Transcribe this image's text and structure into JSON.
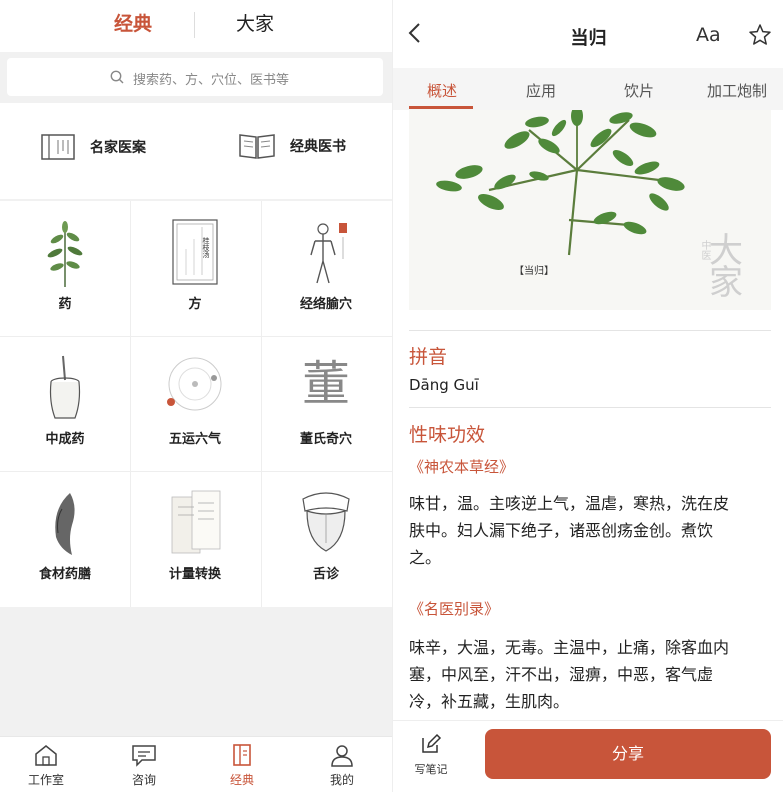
{
  "left": {
    "top_tabs": {
      "active": "经典",
      "inactive": "大家"
    },
    "search": {
      "placeholder": "搜索药、方、穴位、医书等"
    },
    "quick_links": [
      {
        "label": "名家医案",
        "icon": "scroll-icon"
      },
      {
        "label": "经典医书",
        "icon": "open-book-icon"
      }
    ],
    "grid": [
      {
        "label": "药",
        "icon": "herb-icon"
      },
      {
        "label": "方",
        "icon": "prescription-card-icon",
        "card_title": "桂枝汤"
      },
      {
        "label": "经络腧穴",
        "icon": "acupuncture-figure-icon"
      },
      {
        "label": "中成药",
        "icon": "medicine-jar-icon"
      },
      {
        "label": "五运六气",
        "icon": "orbit-icon"
      },
      {
        "label": "董氏奇穴",
        "icon": "dong-character-icon",
        "glyph": "董"
      },
      {
        "label": "食材药膳",
        "icon": "fish-icon"
      },
      {
        "label": "计量转换",
        "icon": "weight-cards-icon"
      },
      {
        "label": "舌诊",
        "icon": "tongue-icon"
      }
    ],
    "bottom_nav": [
      {
        "label": "工作室",
        "icon": "home-icon"
      },
      {
        "label": "咨询",
        "icon": "chat-icon"
      },
      {
        "label": "经典",
        "icon": "book-icon",
        "active": true
      },
      {
        "label": "我的",
        "icon": "user-icon"
      }
    ]
  },
  "right": {
    "title": "当归",
    "font_button": "Aa",
    "tabs": [
      "概述",
      "应用",
      "饮片",
      "加工炮制"
    ],
    "active_tab": "概述",
    "herb_caption": "【当归】",
    "watermark": "大家",
    "watermark_small": "中医",
    "pinyin_title": "拼音",
    "pinyin": "Dāng Guī",
    "properties_title": "性味功效",
    "sources": [
      {
        "title": "《神农本草经》",
        "lines": [
          "味甘，温。主咳逆上气，温虐，寒热，洗在皮",
          "肤中。妇人漏下绝子，诸恶创疡金创。煮饮",
          "之。"
        ]
      },
      {
        "title": "《名医别录》",
        "lines": [
          "味辛，大温，无毒。主温中，止痛，除客血内",
          "塞，中风至，汗不出，湿痹，中恶，客气虚",
          "冷，补五藏，生肌肉。"
        ]
      }
    ],
    "note_label": "写笔记",
    "share_label": "分享"
  },
  "colors": {
    "accent": "#c8553a",
    "text": "#222222",
    "muted": "#888888"
  }
}
